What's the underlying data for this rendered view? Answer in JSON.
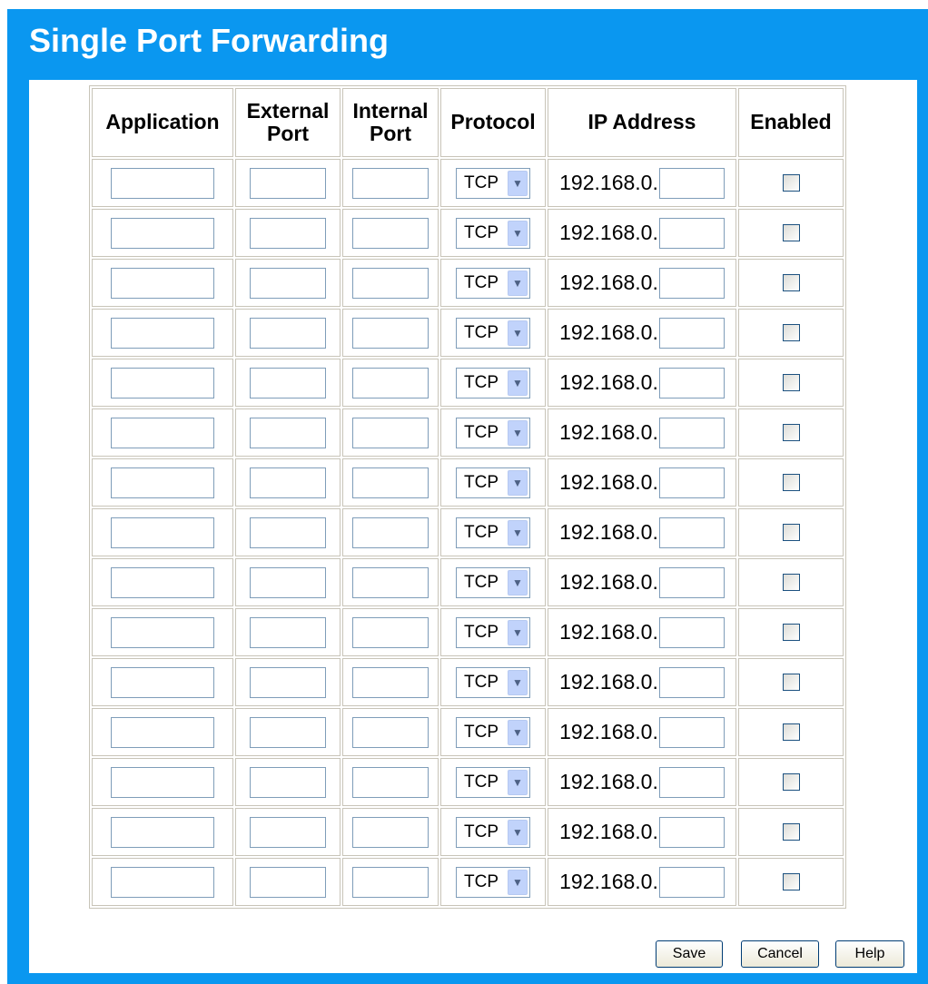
{
  "page": {
    "title": "Single Port Forwarding"
  },
  "table": {
    "headers": {
      "application": "Application",
      "external_port_line1": "External",
      "external_port_line2": "Port",
      "internal_port_line1": "Internal",
      "internal_port_line2": "Port",
      "protocol": "Protocol",
      "ip_address": "IP Address",
      "enabled": "Enabled"
    },
    "rows": [
      {
        "application": "",
        "external_port": "",
        "internal_port": "",
        "protocol": "TCP",
        "ip_prefix": "192.168.0.",
        "ip_last_octet": "",
        "enabled": false
      },
      {
        "application": "",
        "external_port": "",
        "internal_port": "",
        "protocol": "TCP",
        "ip_prefix": "192.168.0.",
        "ip_last_octet": "",
        "enabled": false
      },
      {
        "application": "",
        "external_port": "",
        "internal_port": "",
        "protocol": "TCP",
        "ip_prefix": "192.168.0.",
        "ip_last_octet": "",
        "enabled": false
      },
      {
        "application": "",
        "external_port": "",
        "internal_port": "",
        "protocol": "TCP",
        "ip_prefix": "192.168.0.",
        "ip_last_octet": "",
        "enabled": false
      },
      {
        "application": "",
        "external_port": "",
        "internal_port": "",
        "protocol": "TCP",
        "ip_prefix": "192.168.0.",
        "ip_last_octet": "",
        "enabled": false
      },
      {
        "application": "",
        "external_port": "",
        "internal_port": "",
        "protocol": "TCP",
        "ip_prefix": "192.168.0.",
        "ip_last_octet": "",
        "enabled": false
      },
      {
        "application": "",
        "external_port": "",
        "internal_port": "",
        "protocol": "TCP",
        "ip_prefix": "192.168.0.",
        "ip_last_octet": "",
        "enabled": false
      },
      {
        "application": "",
        "external_port": "",
        "internal_port": "",
        "protocol": "TCP",
        "ip_prefix": "192.168.0.",
        "ip_last_octet": "",
        "enabled": false
      },
      {
        "application": "",
        "external_port": "",
        "internal_port": "",
        "protocol": "TCP",
        "ip_prefix": "192.168.0.",
        "ip_last_octet": "",
        "enabled": false
      },
      {
        "application": "",
        "external_port": "",
        "internal_port": "",
        "protocol": "TCP",
        "ip_prefix": "192.168.0.",
        "ip_last_octet": "",
        "enabled": false
      },
      {
        "application": "",
        "external_port": "",
        "internal_port": "",
        "protocol": "TCP",
        "ip_prefix": "192.168.0.",
        "ip_last_octet": "",
        "enabled": false
      },
      {
        "application": "",
        "external_port": "",
        "internal_port": "",
        "protocol": "TCP",
        "ip_prefix": "192.168.0.",
        "ip_last_octet": "",
        "enabled": false
      },
      {
        "application": "",
        "external_port": "",
        "internal_port": "",
        "protocol": "TCP",
        "ip_prefix": "192.168.0.",
        "ip_last_octet": "",
        "enabled": false
      },
      {
        "application": "",
        "external_port": "",
        "internal_port": "",
        "protocol": "TCP",
        "ip_prefix": "192.168.0.",
        "ip_last_octet": "",
        "enabled": false
      },
      {
        "application": "",
        "external_port": "",
        "internal_port": "",
        "protocol": "TCP",
        "ip_prefix": "192.168.0.",
        "ip_last_octet": "",
        "enabled": false
      }
    ]
  },
  "buttons": {
    "save": "Save",
    "cancel": "Cancel",
    "help": "Help"
  },
  "icons": {
    "dropdown_arrow": "chevron-down-icon"
  },
  "colors": {
    "frame_blue": "#0a97f0",
    "panel": "#ffffff",
    "grid_border": "#c8c4b8"
  }
}
